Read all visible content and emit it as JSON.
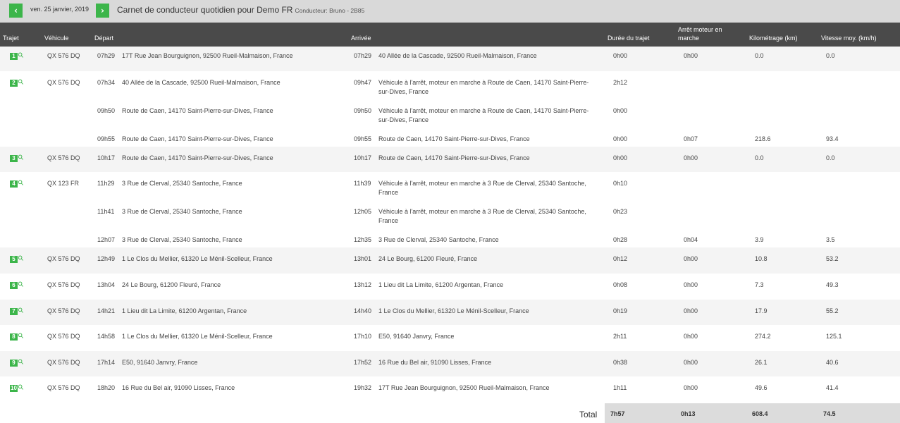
{
  "header": {
    "date": "ven. 25 janvier, 2019",
    "title": "Carnet de conducteur quotidien pour Demo FR",
    "subtitle": "Conducteur: Bruno - 2B85",
    "prev_icon": "chevron-left-icon",
    "next_icon": "chevron-right-icon"
  },
  "columns": {
    "trajet": "Trajet",
    "vehicule": "Véhicule",
    "depart": "Départ",
    "arrivee": "Arrivée",
    "duree": "Durée du trajet",
    "arret_line1": "Arrêt moteur en",
    "arret_line2": "marche",
    "km": "Kilométrage (km)",
    "vitesse": "Vitesse moy. (km/h)"
  },
  "rows": [
    {
      "trip": "1",
      "vehicle": "QX 576 DQ",
      "dep_time": "07h29",
      "dep_addr": "17T Rue Jean Bourguignon, 92500 Rueil-Malmaison, France",
      "arr_time": "07h29",
      "arr_addr": "40 Allée de la Cascade, 92500 Rueil-Malmaison, France",
      "duration": "0h00",
      "idle": "0h00",
      "km": "0.0",
      "speed": "0.0"
    },
    {
      "trip": "2",
      "vehicle": "QX 576 DQ",
      "dep_time": "07h34",
      "dep_addr": "40 Allée de la Cascade, 92500 Rueil-Malmaison, France",
      "arr_time": "09h47",
      "arr_addr": "Véhicule à l'arrêt, moteur en marche à Route de Caen, 14170 Saint-Pierre-sur-Dives, France",
      "duration": "2h12",
      "idle": "",
      "km": "",
      "speed": ""
    },
    {
      "trip": "",
      "vehicle": "",
      "dep_time": "09h50",
      "dep_addr": "Route de Caen, 14170 Saint-Pierre-sur-Dives, France",
      "arr_time": "09h50",
      "arr_addr": "Véhicule à l'arrêt, moteur en marche à Route de Caen, 14170 Saint-Pierre-sur-Dives, France",
      "duration": "0h00",
      "idle": "",
      "km": "",
      "speed": ""
    },
    {
      "trip": "",
      "vehicle": "",
      "dep_time": "09h55",
      "dep_addr": "Route de Caen, 14170 Saint-Pierre-sur-Dives, France",
      "arr_time": "09h55",
      "arr_addr": "Route de Caen, 14170 Saint-Pierre-sur-Dives, France",
      "duration": "0h00",
      "idle": "0h07",
      "km": "218.6",
      "speed": "93.4"
    },
    {
      "trip": "3",
      "vehicle": "QX 576 DQ",
      "dep_time": "10h17",
      "dep_addr": "Route de Caen, 14170 Saint-Pierre-sur-Dives, France",
      "arr_time": "10h17",
      "arr_addr": "Route de Caen, 14170 Saint-Pierre-sur-Dives, France",
      "duration": "0h00",
      "idle": "0h00",
      "km": "0.0",
      "speed": "0.0"
    },
    {
      "trip": "4",
      "vehicle": "QX 123 FR",
      "dep_time": "11h29",
      "dep_addr": "3 Rue de Clerval, 25340 Santoche, France",
      "arr_time": "11h39",
      "arr_addr": "Véhicule à l'arrêt, moteur en marche à 3 Rue de Clerval, 25340 Santoche, France",
      "duration": "0h10",
      "idle": "",
      "km": "",
      "speed": ""
    },
    {
      "trip": "",
      "vehicle": "",
      "dep_time": "11h41",
      "dep_addr": "3 Rue de Clerval, 25340 Santoche, France",
      "arr_time": "12h05",
      "arr_addr": "Véhicule à l'arrêt, moteur en marche à 3 Rue de Clerval, 25340 Santoche, France",
      "duration": "0h23",
      "idle": "",
      "km": "",
      "speed": ""
    },
    {
      "trip": "",
      "vehicle": "",
      "dep_time": "12h07",
      "dep_addr": "3 Rue de Clerval, 25340 Santoche, France",
      "arr_time": "12h35",
      "arr_addr": "3 Rue de Clerval, 25340 Santoche, France",
      "duration": "0h28",
      "idle": "0h04",
      "km": "3.9",
      "speed": "3.5"
    },
    {
      "trip": "5",
      "vehicle": "QX 576 DQ",
      "dep_time": "12h49",
      "dep_addr": "1 Le Clos du Mellier, 61320 Le Ménil-Scelleur, France",
      "arr_time": "13h01",
      "arr_addr": "24 Le Bourg, 61200 Fleuré, France",
      "duration": "0h12",
      "idle": "0h00",
      "km": "10.8",
      "speed": "53.2"
    },
    {
      "trip": "6",
      "vehicle": "QX 576 DQ",
      "dep_time": "13h04",
      "dep_addr": "24 Le Bourg, 61200 Fleuré, France",
      "arr_time": "13h12",
      "arr_addr": "1 Lieu dit La Limite, 61200 Argentan, France",
      "duration": "0h08",
      "idle": "0h00",
      "km": "7.3",
      "speed": "49.3"
    },
    {
      "trip": "7",
      "vehicle": "QX 576 DQ",
      "dep_time": "14h21",
      "dep_addr": "1 Lieu dit La Limite, 61200 Argentan, France",
      "arr_time": "14h40",
      "arr_addr": "1 Le Clos du Mellier, 61320 Le Ménil-Scelleur, France",
      "duration": "0h19",
      "idle": "0h00",
      "km": "17.9",
      "speed": "55.2"
    },
    {
      "trip": "8",
      "vehicle": "QX 576 DQ",
      "dep_time": "14h58",
      "dep_addr": "1 Le Clos du Mellier, 61320 Le Ménil-Scelleur, France",
      "arr_time": "17h10",
      "arr_addr": "E50, 91640 Janvry, France",
      "duration": "2h11",
      "idle": "0h00",
      "km": "274.2",
      "speed": "125.1"
    },
    {
      "trip": "9",
      "vehicle": "QX 576 DQ",
      "dep_time": "17h14",
      "dep_addr": "E50, 91640 Janvry, France",
      "arr_time": "17h52",
      "arr_addr": "16 Rue du Bel air, 91090 Lisses, France",
      "duration": "0h38",
      "idle": "0h00",
      "km": "26.1",
      "speed": "40.6"
    },
    {
      "trip": "10",
      "vehicle": "QX 576 DQ",
      "dep_time": "18h20",
      "dep_addr": "16 Rue du Bel air, 91090 Lisses, France",
      "arr_time": "19h32",
      "arr_addr": "17T Rue Jean Bourguignon, 92500 Rueil-Malmaison, France",
      "duration": "1h11",
      "idle": "0h00",
      "km": "49.6",
      "speed": "41.4"
    }
  ],
  "totals": {
    "label": "Total",
    "duration": "7h57",
    "idle": "0h13",
    "km": "608.4",
    "speed": "74.5"
  },
  "colors": {
    "accent_green": "#3cb54a",
    "header_dark": "#4a4a4a",
    "topbar_gray": "#d9d9d9"
  }
}
